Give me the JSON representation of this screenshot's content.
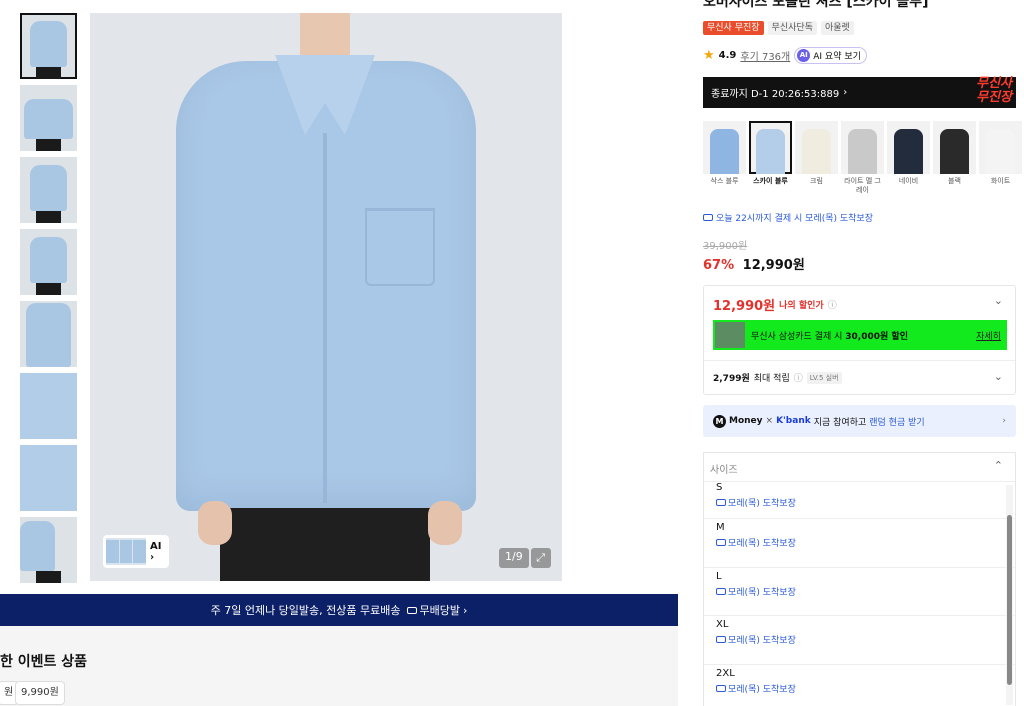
{
  "gallery": {
    "ai_chip_label": "AI",
    "ai_chip_arrow": "›",
    "image_counter": "1/9",
    "expand_icon": "⤢"
  },
  "banner": {
    "text": "주 7일 언제나 당일발송, 전상품 무료배송",
    "ship_label": "무배당발",
    "arrow": "›"
  },
  "event": {
    "title": "한 이벤트 상품",
    "prices": [
      "원",
      "9,990원"
    ]
  },
  "product": {
    "title": "오버사이즈 포플린 셔츠 [스카이 블루]",
    "badges": [
      "무신사 무진장",
      "무신사단독",
      "아울렛"
    ],
    "rating": "4.9",
    "reviews": "후기 736개",
    "ai_summary_icon": "AI",
    "ai_summary": "AI 요약 보기",
    "timer_text": "종료까지 D-1 20:26:53:889",
    "timer_arrow": "›",
    "timer_logo_line1": "무신사",
    "timer_logo_line2": "무진장",
    "colors": [
      {
        "label": "삭스 블루",
        "color": "#8fb6e2",
        "selected": false
      },
      {
        "label": "스카이 블루",
        "color": "#b4cde8",
        "selected": true
      },
      {
        "label": "크림",
        "color": "#f0ece0",
        "selected": false
      },
      {
        "label": "라이트 멜 그레이",
        "color": "#c9c9c9",
        "selected": false
      },
      {
        "label": "네이비",
        "color": "#232c3d",
        "selected": false
      },
      {
        "label": "블랙",
        "color": "#2a2a2a",
        "selected": false
      },
      {
        "label": "화이트",
        "color": "#f4f4f4",
        "selected": false
      }
    ],
    "delivery": "오늘 22시까지 결제 시 모레(목) 도착보장",
    "original_price": "39,900원",
    "discount_pct": "67%",
    "sale_price": "12,990원"
  },
  "discount_box": {
    "my_price": "12,990원",
    "my_label": "나의 할인가",
    "info_icon": "ⓘ",
    "chevron": "⌄",
    "card_text_pre": "무신사 삼성카드 결제 시",
    "card_text_bold": "30,000원 할인",
    "card_more": "자세히",
    "points_amount": "2,799원",
    "points_label": "최대 적립",
    "level_badge": "LV.5 실버"
  },
  "kbank": {
    "m_icon": "M",
    "money": "Money",
    "x": "×",
    "kbank": "K'bank",
    "text": "지금 참여하고",
    "link": "랜덤 현금 받기",
    "arrow": "›"
  },
  "size_select": {
    "placeholder": "사이즈",
    "chevron": "⌃",
    "options": [
      {
        "name": "S",
        "delivery": "모레(목) 도착보장"
      },
      {
        "name": "M",
        "delivery": "모레(목) 도착보장"
      },
      {
        "name": "L",
        "delivery": "모레(목) 도착보장"
      },
      {
        "name": "XL",
        "delivery": "모레(목) 도착보장"
      },
      {
        "name": "2XL",
        "delivery": "모레(목) 도착보장"
      }
    ]
  }
}
